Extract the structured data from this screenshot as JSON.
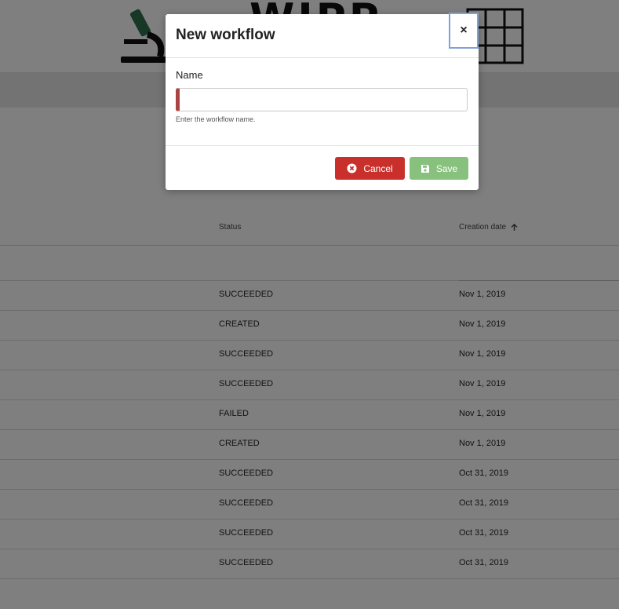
{
  "header": {
    "logo_text": "WIPP"
  },
  "table": {
    "columns": {
      "status": "Status",
      "creation_date": "Creation date"
    },
    "sort_icon": "arrow-up-icon",
    "rows": [
      {
        "status": "SUCCEEDED",
        "date": "Nov 1, 2019"
      },
      {
        "status": "CREATED",
        "date": "Nov 1, 2019"
      },
      {
        "status": "SUCCEEDED",
        "date": "Nov 1, 2019"
      },
      {
        "status": "SUCCEEDED",
        "date": "Nov 1, 2019"
      },
      {
        "status": "FAILED",
        "date": "Nov 1, 2019"
      },
      {
        "status": "CREATED",
        "date": "Nov 1, 2019"
      },
      {
        "status": "SUCCEEDED",
        "date": "Oct 31, 2019"
      },
      {
        "status": "SUCCEEDED",
        "date": "Oct 31, 2019"
      },
      {
        "status": "SUCCEEDED",
        "date": "Oct 31, 2019"
      },
      {
        "status": "SUCCEEDED",
        "date": "Oct 31, 2019"
      }
    ]
  },
  "modal": {
    "title": "New workflow",
    "close_label": "×",
    "name_label": "Name",
    "name_value": "",
    "name_help": "Enter the workflow name.",
    "cancel_label": "Cancel",
    "save_label": "Save",
    "colors": {
      "cancel": "#c9302c",
      "save": "#88c17d",
      "invalid": "#a94442"
    }
  }
}
